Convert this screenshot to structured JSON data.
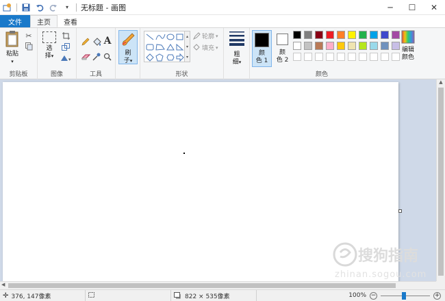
{
  "titlebar": {
    "title": "无标题 - 画图",
    "minimize_glyph": "─",
    "maximize_glyph": "☐",
    "close_glyph": "✕"
  },
  "tabs": [
    {
      "label": "文件"
    },
    {
      "label": "主页"
    },
    {
      "label": "查看"
    }
  ],
  "ribbon": {
    "clipboard": {
      "label": "剪贴板",
      "paste_label": "粘贴"
    },
    "image": {
      "label": "图像",
      "select_label_1": "选",
      "select_label_2": "择"
    },
    "tools": {
      "label": "工具",
      "text_glyph": "A"
    },
    "brushes": {
      "label_1": "刷",
      "label_2": "子"
    },
    "shapes": {
      "label": "形状",
      "outline_label": "轮廓",
      "fill_label": "填充"
    },
    "size": {
      "label_1": "粗",
      "label_2": "细"
    },
    "colors": {
      "label": "颜色",
      "color1_label_1": "颜",
      "color1_label_2": "色 1",
      "color2_label_1": "颜",
      "color2_label_2": "色 2",
      "edit_label_1": "编辑",
      "edit_label_2": "颜色",
      "color1": "#000000",
      "color2": "#ffffff",
      "palette_row1": [
        "#000000",
        "#7f7f7f",
        "#880015",
        "#ed1c24",
        "#ff7f27",
        "#fff200",
        "#22b14c",
        "#00a2e8",
        "#3f48cc",
        "#a349a4"
      ],
      "palette_row2": [
        "#ffffff",
        "#c3c3c3",
        "#b97a57",
        "#ffaec9",
        "#ffc90e",
        "#efe4b0",
        "#b5e61d",
        "#99d9ea",
        "#7092be",
        "#c8bfe7"
      ]
    }
  },
  "status": {
    "cursor_pos": "376, 147像素",
    "image_size": "822 × 535像素",
    "zoom": "100%"
  },
  "watermark": {
    "text_cn": "搜狗指南",
    "text_en": "zhinan.sogou.com"
  }
}
